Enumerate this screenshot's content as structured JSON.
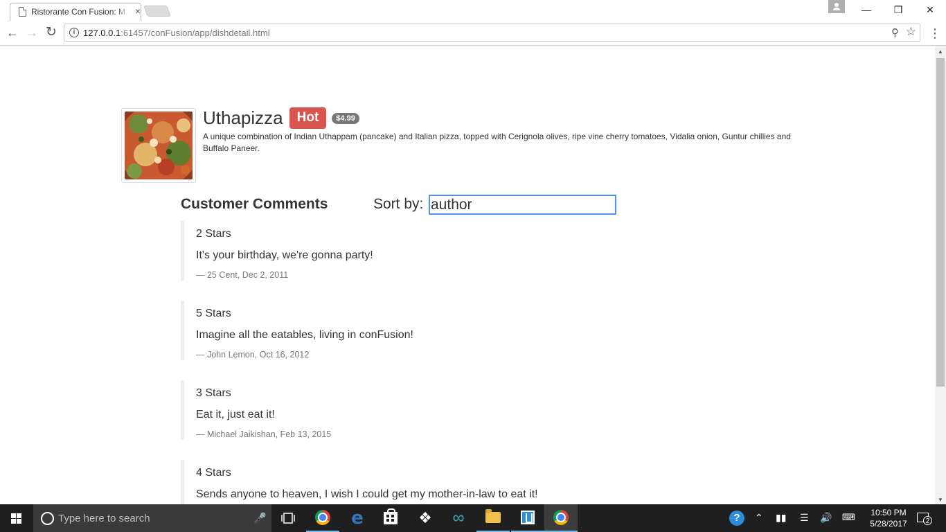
{
  "browser": {
    "tab_title": "Ristorante Con Fusion: M",
    "tab_close": "×",
    "url_host": "127.0.0.1",
    "url_rest": ":61457/conFusion/app/dishdetail.html",
    "window_controls": {
      "minimize": "—",
      "restore": "❐",
      "close": "✕"
    }
  },
  "dish": {
    "name": "Uthapizza",
    "label": "Hot",
    "price": "$4.99",
    "description": "A unique combination of Indian Uthappam (pancake) and Italian pizza, topped with Cerignola olives, ripe vine cherry tomatoes, Vidalia onion, Guntur chillies and Buffalo Paneer."
  },
  "comments_section": {
    "title": "Customer Comments",
    "sort_label": "Sort by:",
    "sort_value": "author"
  },
  "comments": [
    {
      "rating": "2 Stars",
      "text": "It's your birthday, we're gonna party!",
      "author_date": "25 Cent, Dec 2, 2011"
    },
    {
      "rating": "5 Stars",
      "text": "Imagine all the eatables, living in conFusion!",
      "author_date": "John Lemon, Oct 16, 2012"
    },
    {
      "rating": "3 Stars",
      "text": "Eat it, just eat it!",
      "author_date": "Michael Jaikishan, Feb 13, 2015"
    },
    {
      "rating": "4 Stars",
      "text": "Sends anyone to heaven, I wish I could get my mother-in-law to eat it!",
      "author_date": ""
    }
  ],
  "taskbar": {
    "search_placeholder": "Type here to search",
    "clock_time": "10:50 PM",
    "clock_date": "5/28/2017",
    "notification_count": "2"
  },
  "colors": {
    "hot_label": "#d9534f",
    "price_badge": "#777777",
    "focus_border": "#4d90fe",
    "taskbar_bg": "#1f1f1f"
  }
}
